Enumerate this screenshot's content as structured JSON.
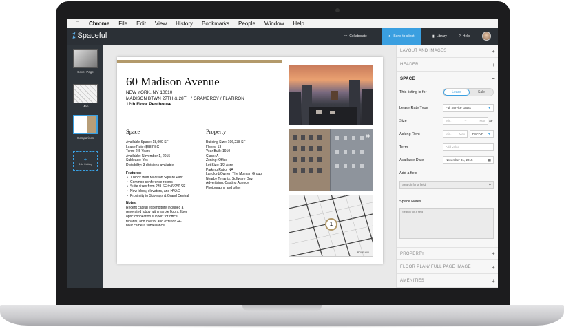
{
  "menubar": {
    "items": [
      "Chrome",
      "File",
      "Edit",
      "View",
      "History",
      "Bookmarks",
      "People",
      "Window",
      "Help"
    ]
  },
  "header": {
    "app_name": "Spaceful",
    "collaborate": "Collaborate",
    "send_to_client": "Send to client",
    "library": "Library",
    "help": "Help"
  },
  "thumbnails": {
    "items": [
      {
        "label": "Cover Page"
      },
      {
        "label": "Map"
      },
      {
        "label": "Comparison"
      }
    ],
    "add_listing": "Add Listing"
  },
  "document": {
    "title": "60 Madison Avenue",
    "address_line1": "NEW YORK, NY 10010",
    "address_line2": "MADISON BTWN 27TH & 28TH / GRAMERCY / FLATIRON",
    "subtitle": "12th Floor Penthouse",
    "space_heading": "Space",
    "property_heading": "Property",
    "space_lines": [
      "Available Space: 18,000 SF",
      "Lease Rate: $58 FSG",
      "Term: 2-5 Years",
      "Available: November 1, 2015",
      "Sublease: Yes",
      "Divisibility: 3 divisions available"
    ],
    "features_label": "Features:",
    "features": [
      "1 block from Madison Square Park",
      "Common conference rooms",
      "Suite sizes from 239 SF to 6,950 SF",
      "New lobby, elevators, and HVAC",
      "Proximity to Subways & Grand Central"
    ],
    "notes_label": "Notes:",
    "notes_lines": [
      "Recent capital expenditure included a",
      "renovated lobby with marble floors, fiber",
      "optic connection support for office",
      "tenants, and interior and exterior 24-",
      "hour camera surveillance."
    ],
    "property_lines": [
      "Building Size: 196,238 SF",
      "Floors: 13",
      "Year Built: 1910",
      "Class: A",
      "Zoning: Office",
      "Lot Size: 1/2 Acre",
      "Parking Ratio: NA",
      "Landlord/Owner: The Moinian Group",
      "Nearby Tenants: Software Dev,",
      "Advertising, Casting Agency,",
      "Photography and other"
    ],
    "map_pin": "1",
    "map_caption": "ROSE HILL"
  },
  "panel": {
    "sections_top": [
      "LAYOUT AND IMAGES",
      "HEADER"
    ],
    "open_section": "SPACE",
    "listing_for_label": "This listing is for",
    "toggle_on": "Lease",
    "toggle_off": "Sale",
    "lease_rate_type_label": "Lease Rate Type",
    "lease_rate_type_value": "Full Service Gross",
    "size_label": "Size",
    "size_min": "Min.",
    "size_max": "Max",
    "size_unit": "SF",
    "asking_rent_label": "Asking Rent",
    "rent_min": "Min.",
    "rent_max": "Max",
    "rent_unit": "PSF/YR",
    "term_label": "Term",
    "term_placeholder": "Add value",
    "available_date_label": "Available Date",
    "available_date_value": "November 31, 2015",
    "add_field_label": "Add a field",
    "search_field_placeholder": "Search for a field",
    "space_notes_label": "Space Notes",
    "notes_placeholder": "Search for a field",
    "sections_bottom": [
      "PROPERTY",
      "FLOOR PLAN/  FULL PAGE IMAGE",
      "AMENITIES"
    ]
  }
}
